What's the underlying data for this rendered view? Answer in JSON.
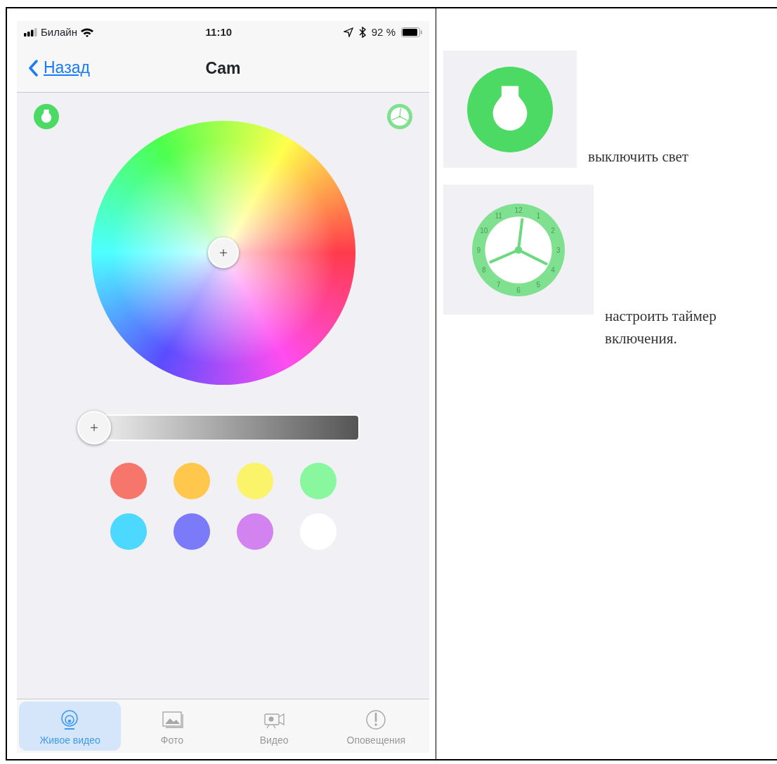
{
  "status_bar": {
    "carrier": "Билайн",
    "time": "11:10",
    "battery": "92 %"
  },
  "nav_bar": {
    "back": "Назад",
    "title": "Cam"
  },
  "brightness": {
    "level": 0.0
  },
  "swatches": [
    {
      "color": "#f7766c"
    },
    {
      "color": "#ffc84c"
    },
    {
      "color": "#fbf36a"
    },
    {
      "color": "#88f79e"
    },
    {
      "color": "#4dd8ff"
    },
    {
      "color": "#7b7bf9"
    },
    {
      "color": "#d283ef"
    },
    {
      "color": "#ffffff"
    }
  ],
  "tabs": [
    {
      "label": "Живое видео",
      "kind": "live",
      "selected": true
    },
    {
      "label": "Фото",
      "kind": "photo",
      "selected": false
    },
    {
      "label": "Видео",
      "kind": "video",
      "selected": false
    },
    {
      "label": "Оповещения",
      "kind": "alert",
      "selected": false
    }
  ],
  "notes": [
    {
      "kind": "bulb",
      "text": "выключить свет"
    },
    {
      "kind": "clock",
      "text": "настроить таймер включения.",
      "dial": [
        "12",
        "1",
        "2",
        "3",
        "4",
        "5",
        "6",
        "7",
        "8",
        "9",
        "10",
        "11"
      ]
    }
  ]
}
